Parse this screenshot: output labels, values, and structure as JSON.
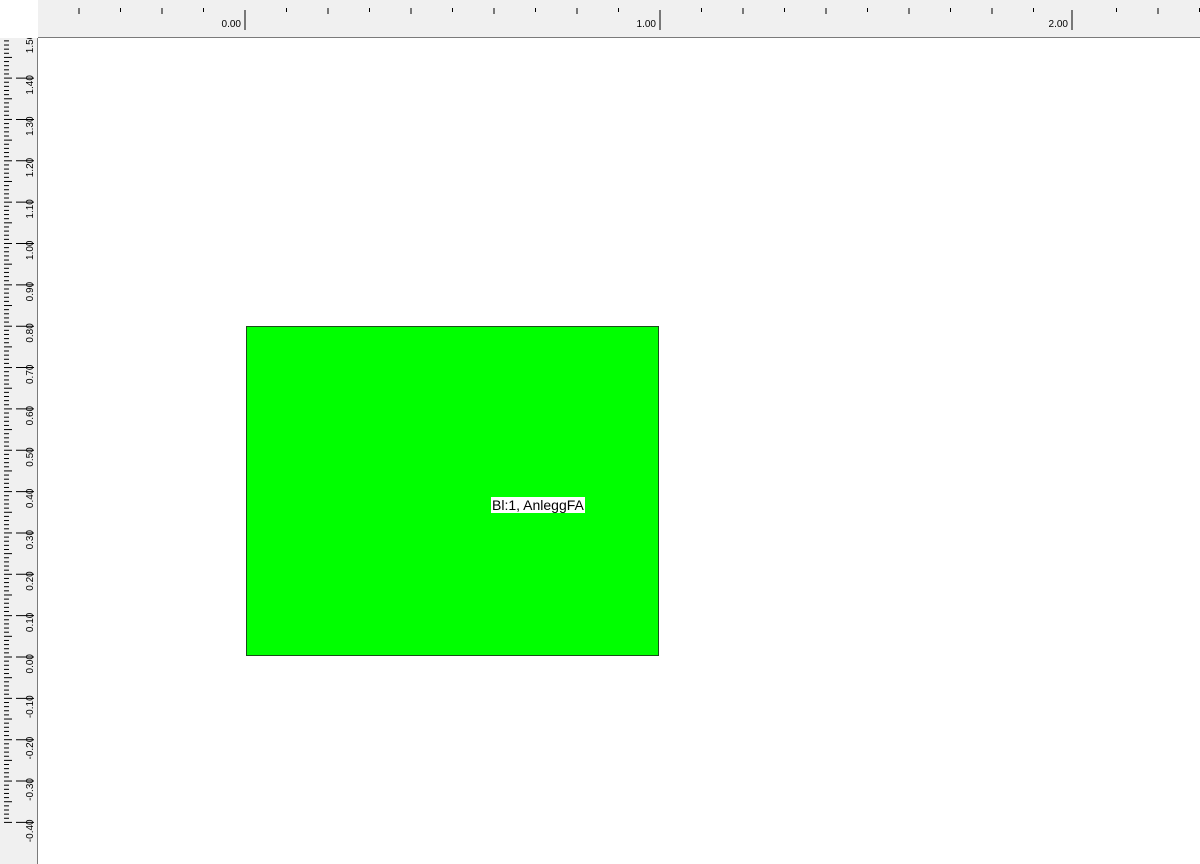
{
  "ruler": {
    "horizontal_labels": [
      "0.00",
      "1.00",
      "2.00"
    ],
    "vertical_labels": [
      "1.50",
      "1.40",
      "1.30",
      "1.20",
      "1.10",
      "1.00",
      "0.90",
      "0.80",
      "0.70",
      "0.60",
      "0.50",
      "0.40",
      "0.30",
      "0.20",
      "0.10",
      "0.00",
      "-0.10",
      "-0.20",
      "-0.30",
      "-0.40"
    ]
  },
  "block": {
    "label": "Bl:1, AnleggFA",
    "fill_color": "#00ff00"
  }
}
